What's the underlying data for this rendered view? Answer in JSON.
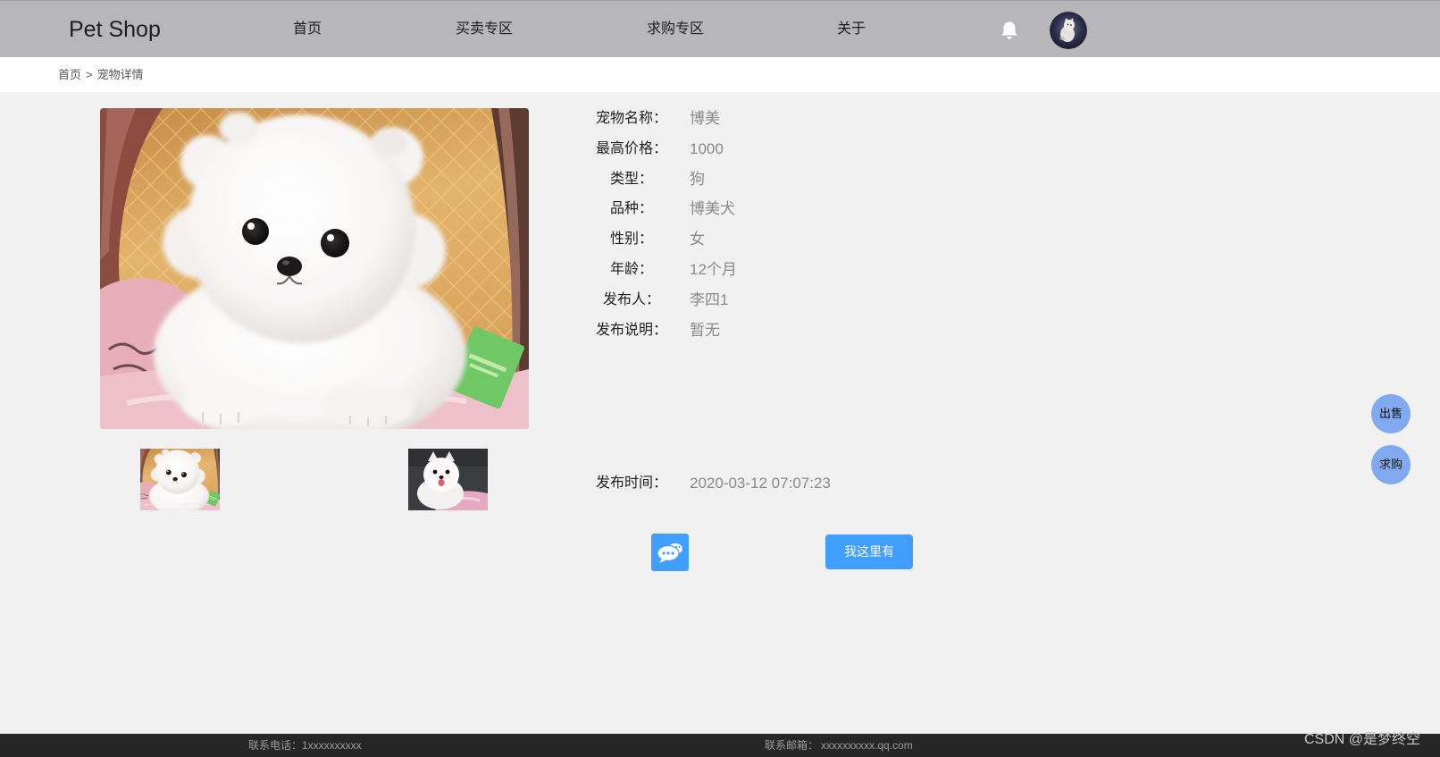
{
  "brand": "Pet Shop",
  "nav": {
    "items": [
      {
        "label": "首页"
      },
      {
        "label": "买卖专区"
      },
      {
        "label": "求购专区"
      },
      {
        "label": "关于"
      }
    ],
    "bell_icon": "bell-icon",
    "avatar_icon": "user-avatar"
  },
  "breadcrumb": {
    "home": "首页",
    "separator": ">",
    "current": "宠物详情"
  },
  "pet": {
    "fields": [
      {
        "label": "宠物名称：",
        "value": "博美"
      },
      {
        "label": "最高价格：",
        "value": "1000"
      },
      {
        "label": "类型：",
        "value": "狗"
      },
      {
        "label": "品种：",
        "value": "博美犬"
      },
      {
        "label": "性别：",
        "value": "女"
      },
      {
        "label": "年龄：",
        "value": "12个月"
      },
      {
        "label": "发布人：",
        "value": "李四1"
      },
      {
        "label": "发布说明：",
        "value": "暂无"
      }
    ],
    "publish_time": {
      "label": "发布时间：",
      "value": "2020-03-12 07:07:23"
    }
  },
  "actions": {
    "chat_icon": "chat-bubble-icon",
    "have_button": "我这里有"
  },
  "float_buttons": {
    "sell": "出售",
    "buy": "求购"
  },
  "footer": {
    "phone": "联系电话：1xxxxxxxxxx",
    "email_label": "联系邮箱：",
    "email_value": "xxxxxxxxxx.qq.com"
  },
  "watermark": "CSDN @是梦终空",
  "colors": {
    "topbar": "#b6b6bb",
    "page_bg": "#f1f1f1",
    "primary": "#409eff",
    "float_button": "#80a9f0",
    "footer": "#262626",
    "value_text": "#8a8a8a"
  }
}
